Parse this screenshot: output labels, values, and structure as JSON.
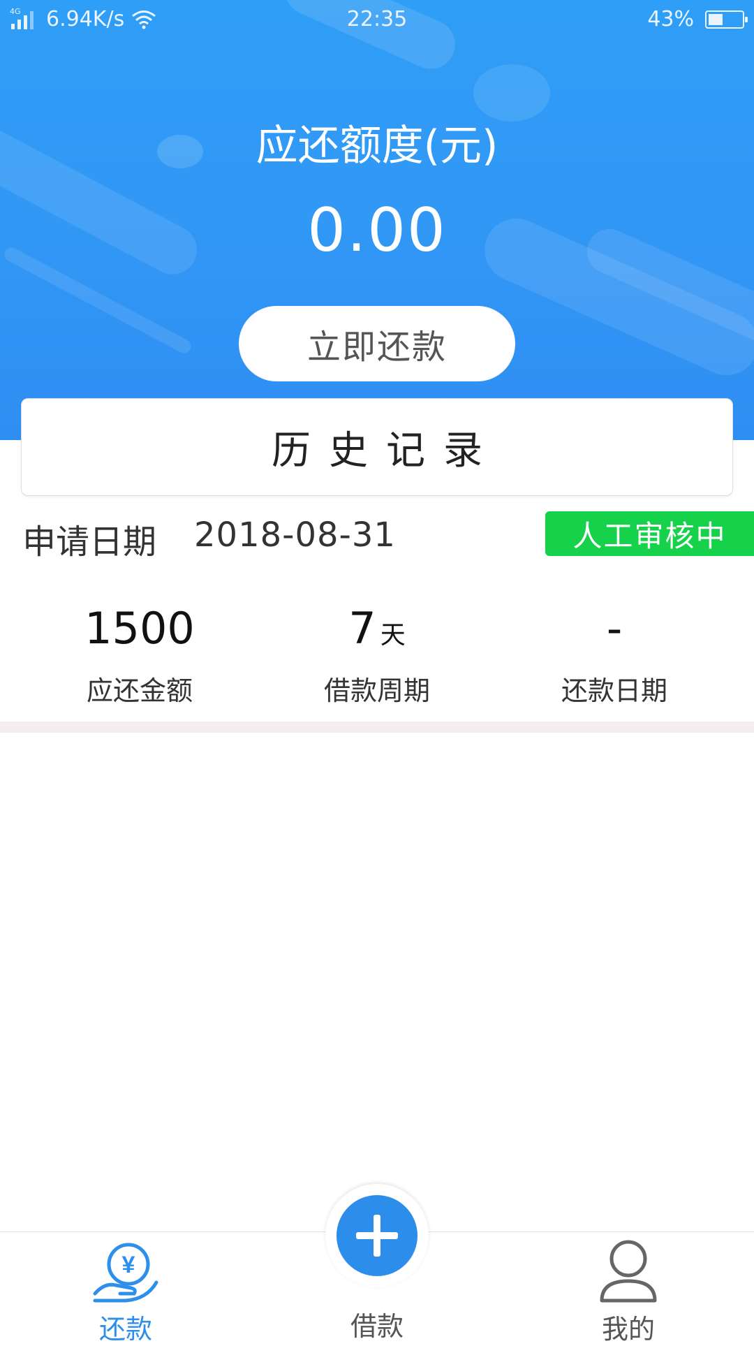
{
  "status_bar": {
    "network_type": "4G",
    "speed": "6.94K/s",
    "time": "22:35",
    "battery_percent_text": "43%",
    "battery_level": 0.43,
    "icons": [
      "signal-icon",
      "wifi-icon",
      "battery-icon"
    ]
  },
  "header": {
    "title": "应还额度(元)",
    "amount": "0.00",
    "repay_button": "立即还款"
  },
  "history": {
    "title": "历史记录"
  },
  "application": {
    "date_label": "申请日期",
    "date_value": "2018-08-31",
    "status": "人工审核中",
    "status_color": "#16d24a"
  },
  "stats": {
    "due_amount_value": "1500",
    "due_amount_label": "应还金额",
    "period_value": "7",
    "period_unit": "天",
    "period_label": "借款周期",
    "repay_date_value": "-",
    "repay_date_label": "还款日期"
  },
  "tabbar": {
    "repay": "还款",
    "borrow": "借款",
    "mine": "我的",
    "active_color": "#2e8fea",
    "icons": [
      "hand-yuan-icon",
      "plus-icon",
      "user-icon"
    ]
  }
}
